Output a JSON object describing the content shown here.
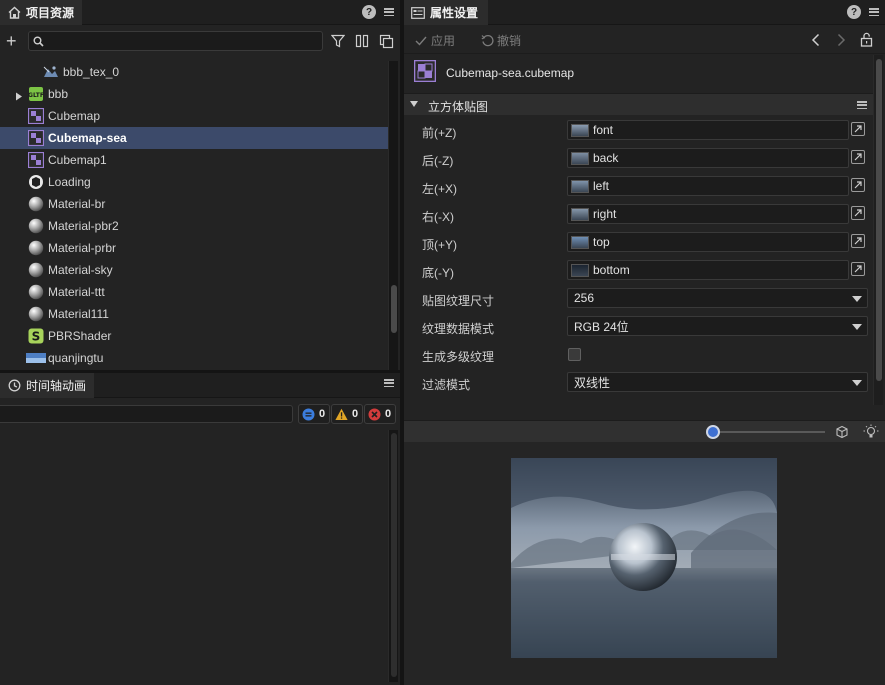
{
  "assets_panel": {
    "title": "项目资源",
    "search_placeholder": "",
    "items": [
      {
        "label": "bbb_tex_0",
        "icon": "texture-icon",
        "selected": false
      },
      {
        "label": "bbb",
        "icon": "gltf-model-icon",
        "selected": false,
        "expandable": true
      },
      {
        "label": "Cubemap",
        "icon": "cubemap-icon",
        "selected": false
      },
      {
        "label": "Cubemap-sea",
        "icon": "cubemap-icon",
        "selected": true
      },
      {
        "label": "Cubemap1",
        "icon": "cubemap-icon",
        "selected": false
      },
      {
        "label": "Loading",
        "icon": "prefab-icon",
        "selected": false
      },
      {
        "label": "Material-br",
        "icon": "material-sphere-icon",
        "selected": false
      },
      {
        "label": "Material-pbr2",
        "icon": "material-sphere-icon",
        "selected": false
      },
      {
        "label": "Material-prbr",
        "icon": "material-sphere-icon",
        "selected": false
      },
      {
        "label": "Material-sky",
        "icon": "material-sphere-icon",
        "selected": false
      },
      {
        "label": "Material-ttt",
        "icon": "material-sphere-icon",
        "selected": false
      },
      {
        "label": "Material111",
        "icon": "material-sphere-icon",
        "selected": false
      },
      {
        "label": "PBRShader",
        "icon": "shader-icon",
        "selected": false
      },
      {
        "label": "quanjingtu",
        "icon": "panorama-image-icon",
        "selected": false
      }
    ]
  },
  "timeline_panel": {
    "title": "时间轴动画",
    "search_value": "",
    "badges": {
      "info": "0",
      "warning": "0",
      "error": "0"
    }
  },
  "properties_panel": {
    "title": "属性设置",
    "apply_label": "应用",
    "undo_label": "撤销",
    "file_name": "Cubemap-sea.cubemap",
    "section_title": "立方体贴图",
    "faces": [
      {
        "label": "前(+Z)",
        "value": "font",
        "color": "#8a9bb0"
      },
      {
        "label": "后(-Z)",
        "value": "back",
        "color": "#7d8da1"
      },
      {
        "label": "左(+X)",
        "value": "left",
        "color": "#7f93ab"
      },
      {
        "label": "右(-X)",
        "value": "right",
        "color": "#8596a9"
      },
      {
        "label": "顶(+Y)",
        "value": "top",
        "color": "#6f8fb5"
      },
      {
        "label": "底(-Y)",
        "value": "bottom",
        "color": "#1b2430"
      }
    ],
    "texture_size_label": "贴图纹理尺寸",
    "texture_size_value": "256",
    "data_mode_label": "纹理数据模式",
    "data_mode_value": "RGB 24位",
    "mipmap_label": "生成多级纹理",
    "mipmap_checked": false,
    "filter_label": "过滤模式",
    "filter_value": "双线性",
    "preview_zoom": 0.0
  },
  "colors": {
    "selection": "#3c4a6a",
    "accent": "#3e6fd0",
    "panel": "#232323",
    "cubemap_icon": "#9b7fd4"
  }
}
